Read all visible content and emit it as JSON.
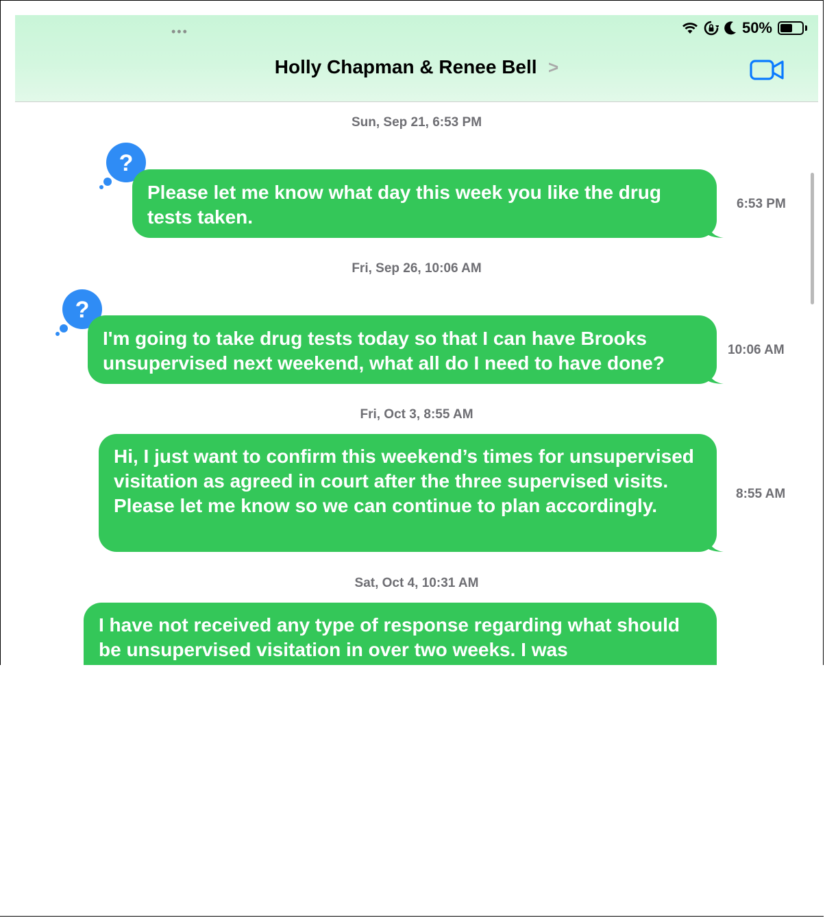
{
  "status_bar": {
    "dots": "•••",
    "battery": "50%"
  },
  "header": {
    "title": "Holly Chapman & Renee Bell",
    "chevron": ">"
  },
  "messages": [
    {
      "date": "Sun, Sep 21, 6:53 PM",
      "text": "Please let me know what day this week you like the drug tests taken.",
      "time": "6:53 PM",
      "reaction": "?"
    },
    {
      "date": "Fri, Sep 26, 10:06 AM",
      "text": "I'm going to take drug tests today so that I can have Brooks unsupervised next weekend, what all do I need to have done?",
      "time": "10:06 AM",
      "reaction": "?"
    },
    {
      "date": "Fri, Oct 3, 8:55 AM",
      "text": "Hi, I just want to confirm this weekend’s times for unsupervised visitation as agreed in court after the three supervised visits. Please let me know so we can continue to plan accordingly.",
      "time": "8:55 AM"
    },
    {
      "date": "Sat, Oct 4, 10:31 AM",
      "text": "I have not received any type of response regarding what should be unsupervised visitation in over two weeks. I was"
    }
  ],
  "colors": {
    "bubble": "#34c759",
    "reaction": "#2f8cf5",
    "accent": "#0a7aff"
  }
}
